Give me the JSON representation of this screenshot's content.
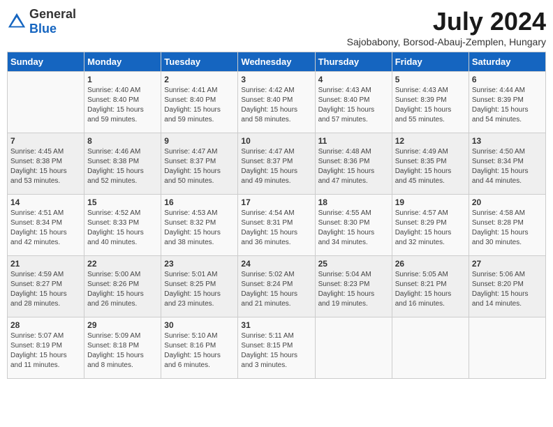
{
  "logo": {
    "general": "General",
    "blue": "Blue"
  },
  "header": {
    "month_year": "July 2024",
    "location": "Sajobabony, Borsod-Abauj-Zemplen, Hungary"
  },
  "days_of_week": [
    "Sunday",
    "Monday",
    "Tuesday",
    "Wednesday",
    "Thursday",
    "Friday",
    "Saturday"
  ],
  "weeks": [
    [
      {
        "day": "",
        "content": ""
      },
      {
        "day": "1",
        "content": "Sunrise: 4:40 AM\nSunset: 8:40 PM\nDaylight: 15 hours\nand 59 minutes."
      },
      {
        "day": "2",
        "content": "Sunrise: 4:41 AM\nSunset: 8:40 PM\nDaylight: 15 hours\nand 59 minutes."
      },
      {
        "day": "3",
        "content": "Sunrise: 4:42 AM\nSunset: 8:40 PM\nDaylight: 15 hours\nand 58 minutes."
      },
      {
        "day": "4",
        "content": "Sunrise: 4:43 AM\nSunset: 8:40 PM\nDaylight: 15 hours\nand 57 minutes."
      },
      {
        "day": "5",
        "content": "Sunrise: 4:43 AM\nSunset: 8:39 PM\nDaylight: 15 hours\nand 55 minutes."
      },
      {
        "day": "6",
        "content": "Sunrise: 4:44 AM\nSunset: 8:39 PM\nDaylight: 15 hours\nand 54 minutes."
      }
    ],
    [
      {
        "day": "7",
        "content": "Sunrise: 4:45 AM\nSunset: 8:38 PM\nDaylight: 15 hours\nand 53 minutes."
      },
      {
        "day": "8",
        "content": "Sunrise: 4:46 AM\nSunset: 8:38 PM\nDaylight: 15 hours\nand 52 minutes."
      },
      {
        "day": "9",
        "content": "Sunrise: 4:47 AM\nSunset: 8:37 PM\nDaylight: 15 hours\nand 50 minutes."
      },
      {
        "day": "10",
        "content": "Sunrise: 4:47 AM\nSunset: 8:37 PM\nDaylight: 15 hours\nand 49 minutes."
      },
      {
        "day": "11",
        "content": "Sunrise: 4:48 AM\nSunset: 8:36 PM\nDaylight: 15 hours\nand 47 minutes."
      },
      {
        "day": "12",
        "content": "Sunrise: 4:49 AM\nSunset: 8:35 PM\nDaylight: 15 hours\nand 45 minutes."
      },
      {
        "day": "13",
        "content": "Sunrise: 4:50 AM\nSunset: 8:34 PM\nDaylight: 15 hours\nand 44 minutes."
      }
    ],
    [
      {
        "day": "14",
        "content": "Sunrise: 4:51 AM\nSunset: 8:34 PM\nDaylight: 15 hours\nand 42 minutes."
      },
      {
        "day": "15",
        "content": "Sunrise: 4:52 AM\nSunset: 8:33 PM\nDaylight: 15 hours\nand 40 minutes."
      },
      {
        "day": "16",
        "content": "Sunrise: 4:53 AM\nSunset: 8:32 PM\nDaylight: 15 hours\nand 38 minutes."
      },
      {
        "day": "17",
        "content": "Sunrise: 4:54 AM\nSunset: 8:31 PM\nDaylight: 15 hours\nand 36 minutes."
      },
      {
        "day": "18",
        "content": "Sunrise: 4:55 AM\nSunset: 8:30 PM\nDaylight: 15 hours\nand 34 minutes."
      },
      {
        "day": "19",
        "content": "Sunrise: 4:57 AM\nSunset: 8:29 PM\nDaylight: 15 hours\nand 32 minutes."
      },
      {
        "day": "20",
        "content": "Sunrise: 4:58 AM\nSunset: 8:28 PM\nDaylight: 15 hours\nand 30 minutes."
      }
    ],
    [
      {
        "day": "21",
        "content": "Sunrise: 4:59 AM\nSunset: 8:27 PM\nDaylight: 15 hours\nand 28 minutes."
      },
      {
        "day": "22",
        "content": "Sunrise: 5:00 AM\nSunset: 8:26 PM\nDaylight: 15 hours\nand 26 minutes."
      },
      {
        "day": "23",
        "content": "Sunrise: 5:01 AM\nSunset: 8:25 PM\nDaylight: 15 hours\nand 23 minutes."
      },
      {
        "day": "24",
        "content": "Sunrise: 5:02 AM\nSunset: 8:24 PM\nDaylight: 15 hours\nand 21 minutes."
      },
      {
        "day": "25",
        "content": "Sunrise: 5:04 AM\nSunset: 8:23 PM\nDaylight: 15 hours\nand 19 minutes."
      },
      {
        "day": "26",
        "content": "Sunrise: 5:05 AM\nSunset: 8:21 PM\nDaylight: 15 hours\nand 16 minutes."
      },
      {
        "day": "27",
        "content": "Sunrise: 5:06 AM\nSunset: 8:20 PM\nDaylight: 15 hours\nand 14 minutes."
      }
    ],
    [
      {
        "day": "28",
        "content": "Sunrise: 5:07 AM\nSunset: 8:19 PM\nDaylight: 15 hours\nand 11 minutes."
      },
      {
        "day": "29",
        "content": "Sunrise: 5:09 AM\nSunset: 8:18 PM\nDaylight: 15 hours\nand 8 minutes."
      },
      {
        "day": "30",
        "content": "Sunrise: 5:10 AM\nSunset: 8:16 PM\nDaylight: 15 hours\nand 6 minutes."
      },
      {
        "day": "31",
        "content": "Sunrise: 5:11 AM\nSunset: 8:15 PM\nDaylight: 15 hours\nand 3 minutes."
      },
      {
        "day": "",
        "content": ""
      },
      {
        "day": "",
        "content": ""
      },
      {
        "day": "",
        "content": ""
      }
    ]
  ]
}
